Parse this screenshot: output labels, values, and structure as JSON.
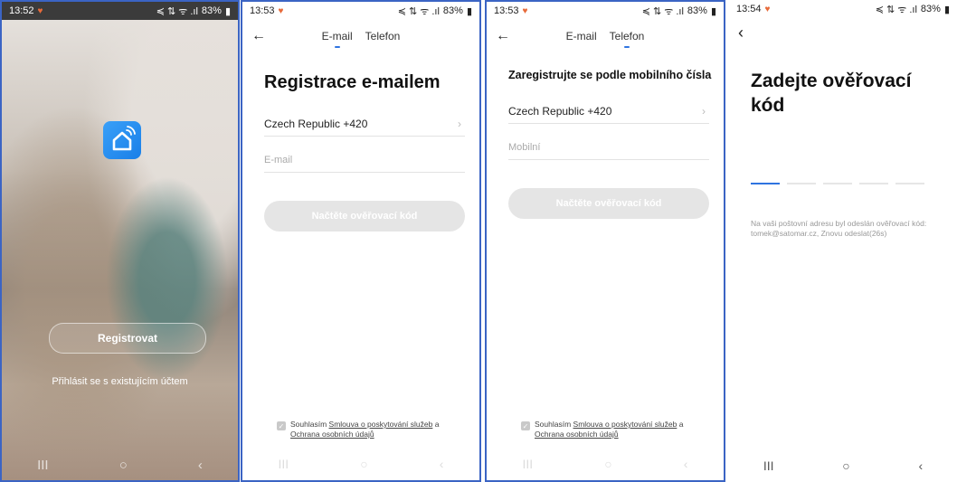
{
  "screen1": {
    "time": "13:52",
    "status_icons": "≼ ⇅ ᯤ .ıl",
    "battery": "83%",
    "register_label": "Registrovat",
    "login_link": "Přihlásit se s existujícím účtem",
    "nav": [
      "III",
      "○",
      "‹"
    ]
  },
  "screen2": {
    "time": "13:53",
    "status_icons": "≼ ⇅ ᯤ .ıl",
    "battery": "83%",
    "back": "←",
    "tabs": [
      {
        "label": "E-mail",
        "active": true
      },
      {
        "label": "Telefon",
        "active": false
      }
    ],
    "heading": "Registrace e-mailem",
    "country": "Czech Republic +420",
    "email_placeholder": "E-mail",
    "button": "Načtěte ověřovací kód",
    "agree_prefix": "Souhlasím ",
    "agree_link1": "Smlouva o poskytování služeb",
    "agree_mid": " a ",
    "agree_link2": "Ochrana osobních údajů",
    "nav": [
      "III",
      "○",
      "‹"
    ]
  },
  "screen3": {
    "time": "13:53",
    "status_icons": "≼ ⇅ ᯤ .ıl",
    "battery": "83%",
    "back": "←",
    "tabs": [
      {
        "label": "E-mail",
        "active": false
      },
      {
        "label": "Telefon",
        "active": true
      }
    ],
    "heading": "Zaregistrujte se podle mobilního čísla",
    "country": "Czech Republic +420",
    "mobile_placeholder": "Mobilní",
    "button": "Načtěte ověřovací kód",
    "agree_prefix": "Souhlasím ",
    "agree_link1": "Smlouva o poskytování služeb",
    "agree_mid": " a ",
    "agree_link2": "Ochrana osobních údajů",
    "nav": [
      "III",
      "○",
      "‹"
    ]
  },
  "screen4": {
    "time": "13:54",
    "status_icons": "≼ ⇅ ᯤ .ıl",
    "battery": "83%",
    "back": "‹",
    "heading": "Zadejte ověřovací kód",
    "info": "Na vaši poštovní adresu byl odeslán ověřovací kód: tomek@satomar.cz, Znovu odeslat(26s)",
    "nav": [
      "III",
      "○",
      "‹"
    ]
  },
  "colors": {
    "accent": "#2f74e0",
    "frame": "#3b64c4",
    "disabled_button": "#e5e5e5",
    "status_heart": "#e76a3a"
  }
}
